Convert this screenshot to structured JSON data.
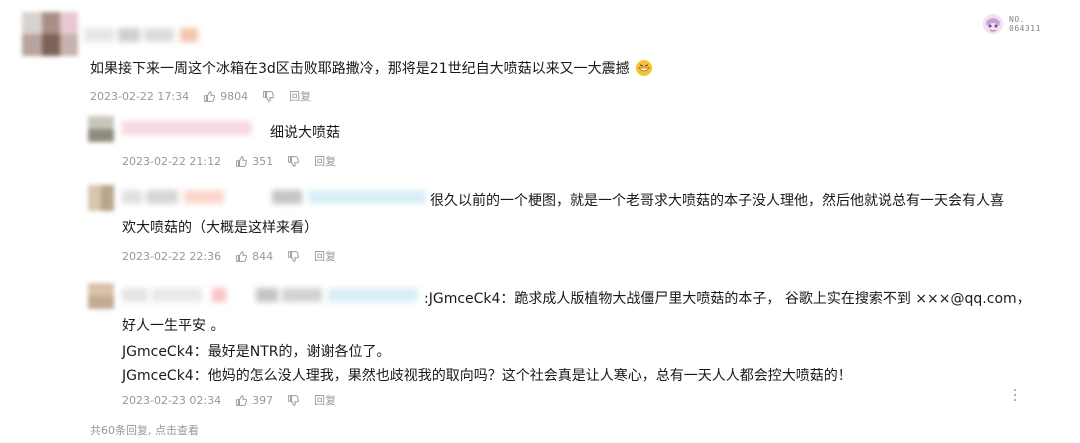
{
  "comment": {
    "text": "如果接下来一周这个冰箱在3d区击败耶路撒冷，那将是21世纪自大喷菇以来又一大震撼",
    "date": "2023-02-22 17:34",
    "likes": "9804",
    "reply_label": "回复",
    "badge_line1": "NO.",
    "badge_line2": "064311"
  },
  "replies": [
    {
      "text": "细说大喷菇",
      "date": "2023-02-22 21:12",
      "likes": "351",
      "reply_label": "回复"
    },
    {
      "text_line1": "很久以前的一个梗图，就是一个老哥求大喷菇的本子没人理他，然后他就说总有一天会有人喜",
      "text_line2": "欢大喷菇的（大概是这样来看）",
      "date": "2023-02-22 22:36",
      "likes": "844",
      "reply_label": "回复"
    },
    {
      "text_line1": ":JGmceCk4：跪求成人版植物大战僵尸里大喷菇的本子， 谷歌上实在搜索不到 ×××@qq.com，",
      "text_line2": "好人一生平安 。",
      "text_line3": "JGmceCk4：最好是NTR的，谢谢各位了。",
      "text_line4": " JGmceCk4：他妈的怎么没人理我，果然也歧视我的取向吗？这个社会真是让人寒心，总有一天人人都会控大喷菇的！",
      "date": "2023-02-23 02:34",
      "likes": "397",
      "reply_label": "回复"
    }
  ],
  "footer": {
    "label": "共60条回复, 点击查看"
  },
  "colors": {
    "text": "#18191c",
    "meta": "#9499a0",
    "accent": "#00aeec"
  }
}
